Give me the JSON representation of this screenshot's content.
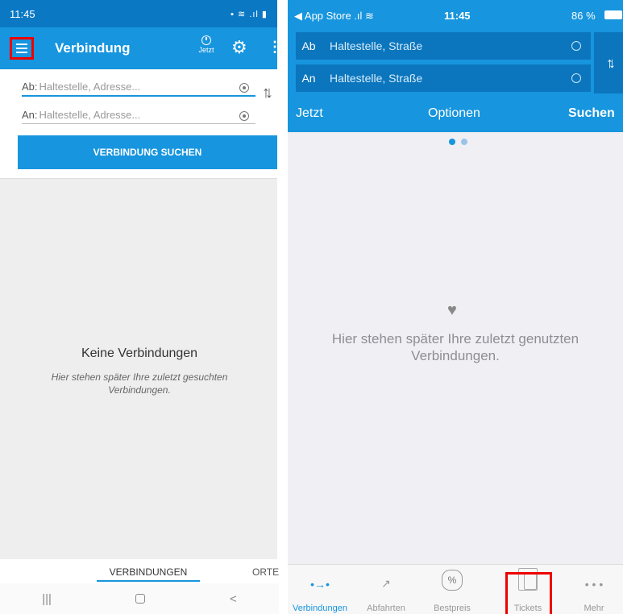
{
  "android": {
    "status": {
      "time": "11:45",
      "icons": "▪︎ ≋ .ıl ▮"
    },
    "appbar": {
      "title": "Verbindung",
      "jetzt": "Jetzt",
      "gear": "gear-icon",
      "more": "more-vertical-icon"
    },
    "form": {
      "ab_prefix": "Ab:",
      "ab_placeholder": "Haltestelle, Adresse...",
      "an_prefix": "An:",
      "an_placeholder": "Haltestelle, Adresse...",
      "search_button": "VERBINDUNG SUCHEN"
    },
    "empty": {
      "title": "Keine Verbindungen",
      "subtitle": "Hier stehen später Ihre zuletzt gesuchten Verbindungen."
    },
    "tabs": {
      "tab1": "VERBINDUNGEN",
      "tab2": "ORTE"
    },
    "nav": {
      "recents": "|||",
      "home": "home",
      "back": "<"
    }
  },
  "ios": {
    "status": {
      "back": "◀ App Store .ıl ≋",
      "time": "11:45",
      "battery": "86 %"
    },
    "form": {
      "ab_prefix": "Ab",
      "ab_value": "Haltestelle, Straße",
      "an_prefix": "An",
      "an_value": "Haltestelle, Straße"
    },
    "bar": {
      "jetzt": "Jetzt",
      "optionen": "Optionen",
      "suchen": "Suchen"
    },
    "empty": {
      "text": "Hier stehen später Ihre zuletzt genutzten Verbindungen."
    },
    "tabbar": [
      {
        "label": "Verbindungen",
        "icon": "connections-icon",
        "active": true
      },
      {
        "label": "Abfahrten",
        "icon": "departures-icon",
        "active": false
      },
      {
        "label": "Bestpreis",
        "icon": "bestprice-icon",
        "active": false
      },
      {
        "label": "Tickets",
        "icon": "tickets-icon",
        "active": false
      },
      {
        "label": "Mehr",
        "icon": "more-icon",
        "active": false
      }
    ]
  },
  "colors": {
    "primary": "#1795de",
    "dark_primary": "#0b76bd",
    "highlight": "#e00000"
  }
}
